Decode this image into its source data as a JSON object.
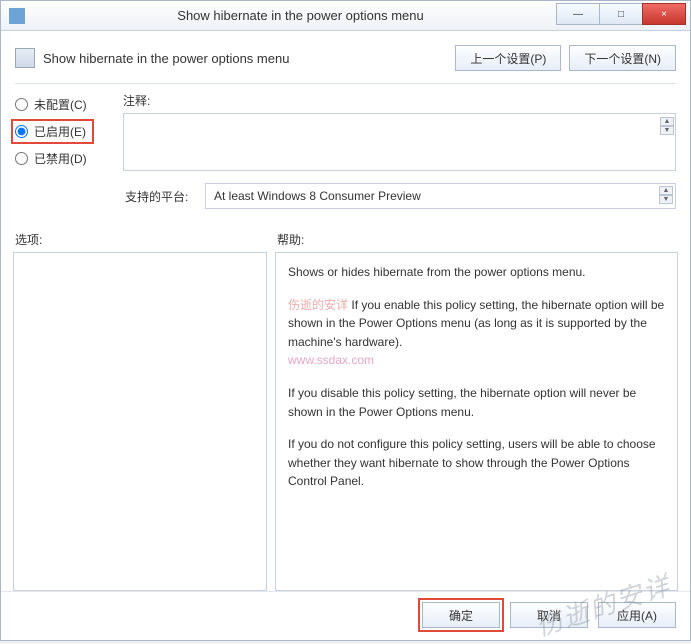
{
  "window": {
    "title": "Show hibernate in the power options menu"
  },
  "titlebar_buttons": {
    "minimize": "—",
    "maximize": "□",
    "close": "×"
  },
  "header": {
    "title": "Show hibernate in the power options menu",
    "prev_btn": "上一个设置(P)",
    "next_btn": "下一个设置(N)"
  },
  "radios": {
    "not_configured": "未配置(C)",
    "enabled": "已启用(E)",
    "disabled": "已禁用(D)",
    "selected": "enabled"
  },
  "comment": {
    "label": "注释:",
    "value": ""
  },
  "platform": {
    "label": "支持的平台:",
    "value": "At least Windows 8 Consumer Preview"
  },
  "sections": {
    "options_label": "选项:",
    "help_label": "帮助:"
  },
  "help_text": {
    "p1": "Shows or hides hibernate from the power options menu.",
    "p2a": "If you enable this policy setting, the hibernate option will be shown in the Power Options menu (as long as it is supported by the machine's hardware).",
    "p3": "If you disable this policy setting, the hibernate option will never be shown in the Power Options menu.",
    "p4": "If you do not configure this policy setting, users will be able to choose whether they want hibernate to show through the Power Options Control Panel."
  },
  "watermarks": {
    "inline1": "伤逝的安详",
    "inline2": "www.ssdax.com",
    "corner": "伤逝的安详"
  },
  "footer": {
    "ok": "确定",
    "cancel": "取消",
    "apply": "应用(A)"
  }
}
